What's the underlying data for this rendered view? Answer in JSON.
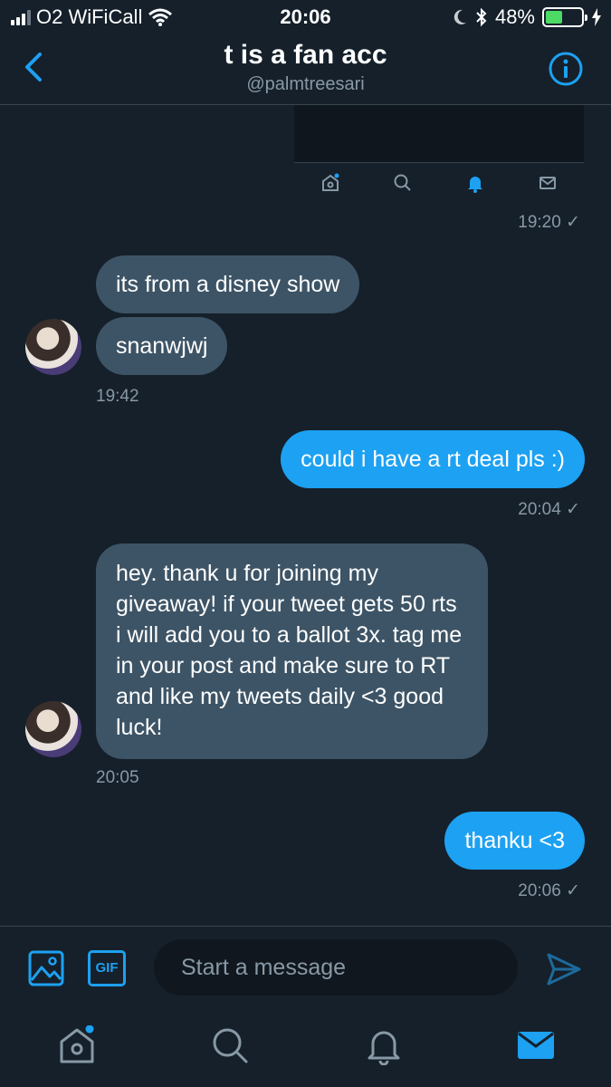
{
  "status_bar": {
    "carrier": "O2 WiFiCall",
    "time": "20:06",
    "battery": "48%",
    "battery_level": 0.48
  },
  "header": {
    "title": "t is a fan acc",
    "handle": "@palmtreesari"
  },
  "messages": [
    {
      "time": "19:20 ✓"
    },
    {
      "text": "its from a disney show"
    },
    {
      "text": "snanwjwj",
      "time": "19:42"
    },
    {
      "text": "could i have a rt deal pls :)",
      "time": "20:04 ✓"
    },
    {
      "text": "hey. thank u for joining my giveaway! if your tweet gets 50 rts i will add you to a ballot 3x. tag me in your post and make sure to RT and like my tweets daily <3 good luck!",
      "time": "20:05"
    },
    {
      "text": "thanku <3",
      "time": "20:06 ✓"
    }
  ],
  "composer": {
    "placeholder": "Start a message",
    "gif_label": "GIF"
  },
  "colors": {
    "background": "#15202b",
    "accent": "#1da1f2",
    "incoming_bubble": "#3d5466",
    "secondary_text": "#8899a6"
  }
}
